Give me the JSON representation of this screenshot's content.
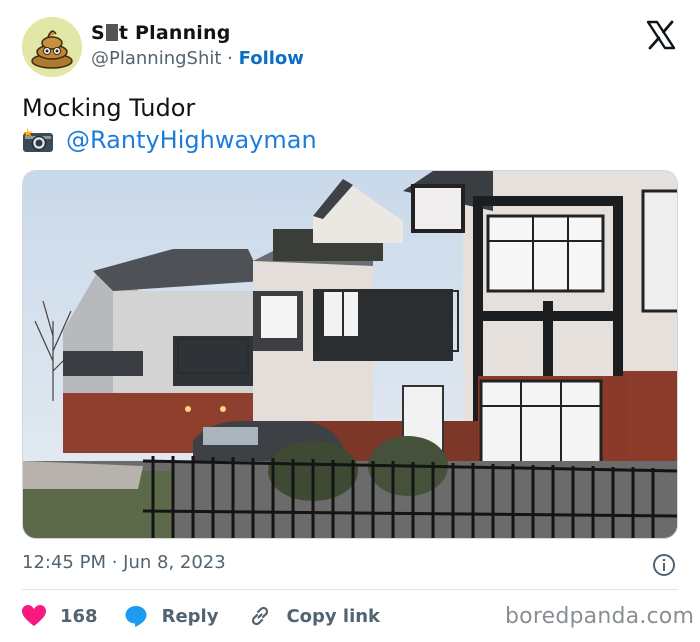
{
  "author": {
    "name_prefix": "S",
    "name_suffix": "t Planning",
    "handle": "@PlanningShit",
    "separator": "·",
    "follow_label": "Follow"
  },
  "tweet": {
    "text": "Mocking Tudor",
    "mention": "@RantyHighwayman",
    "timestamp": "12:45 PM · Jun 8, 2023"
  },
  "actions": {
    "like_count": "168",
    "reply_label": "Reply",
    "copy_label": "Copy link"
  },
  "watermark": "boredpanda.com",
  "colors": {
    "link": "#1d7dd8",
    "like": "#f91880",
    "muted": "#536471"
  }
}
